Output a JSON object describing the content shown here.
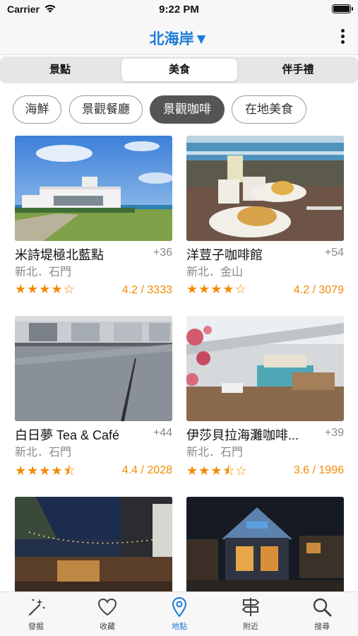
{
  "status": {
    "carrier": "Carrier",
    "time": "9:22 PM"
  },
  "nav": {
    "title": "北海岸▼"
  },
  "segments": [
    {
      "label": "景點"
    },
    {
      "label": "美食"
    },
    {
      "label": "伴手禮"
    }
  ],
  "active_segment": "美食",
  "chips": [
    {
      "label": "海鮮"
    },
    {
      "label": "景觀餐廳"
    },
    {
      "label": "景觀咖啡"
    },
    {
      "label": "在地美食"
    }
  ],
  "active_chip": "景觀咖啡",
  "cards": [
    {
      "name": "米詩堤極北藍點",
      "count": "+36",
      "location": "新北．石門",
      "stars": "★★★★☆",
      "rating": 4.2,
      "score_text": "4.2 / 3333"
    },
    {
      "name": "洋荳子咖啡館",
      "count": "+54",
      "location": "新北．金山",
      "stars": "★★★★☆",
      "rating": 4.2,
      "score_text": "4.2 / 3079"
    },
    {
      "name": "白日夢 Tea & Café",
      "count": "+44",
      "location": "新北．石門",
      "stars": "★★★★⯪",
      "rating": 4.4,
      "score_text": "4.4 / 2028"
    },
    {
      "name": "伊莎貝拉海灘咖啡...",
      "count": "+39",
      "location": "新北．石門",
      "stars": "★★★⯪☆",
      "rating": 3.6,
      "score_text": "3.6 / 1996"
    },
    {
      "name": "",
      "count": "",
      "location": "",
      "stars": "",
      "score_text": ""
    },
    {
      "name": "",
      "count": "",
      "location": "",
      "stars": "",
      "score_text": ""
    }
  ],
  "tabs": [
    {
      "label": "發掘",
      "icon": "magic-wand-icon"
    },
    {
      "label": "收藏",
      "icon": "heart-icon"
    },
    {
      "label": "地點",
      "icon": "map-pin-icon"
    },
    {
      "label": "附近",
      "icon": "signpost-icon"
    },
    {
      "label": "搜尋",
      "icon": "search-icon"
    }
  ],
  "active_tab": "地點",
  "colors": {
    "accent": "#1a7ad9",
    "star": "#f28a00",
    "chip_active": "#555555"
  }
}
